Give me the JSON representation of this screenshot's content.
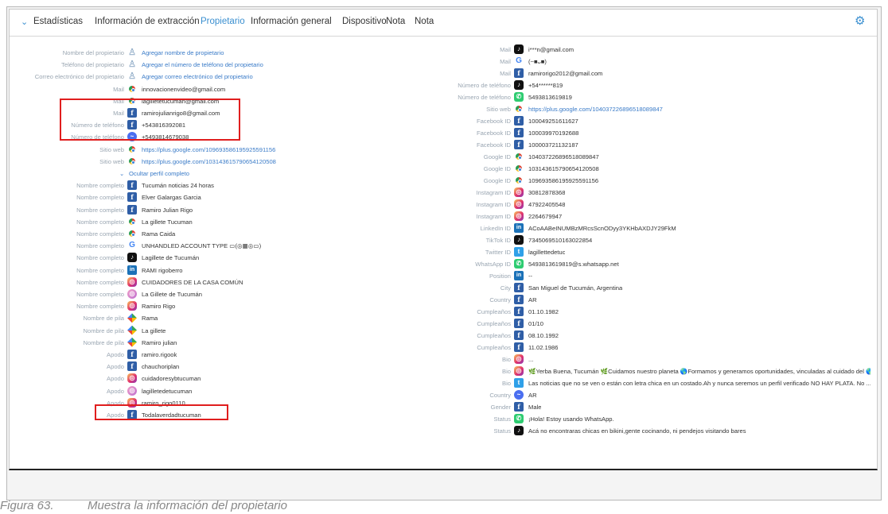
{
  "tabs": {
    "items": [
      "Estadísticas",
      "Información de extracción",
      "Propietario",
      "Información general",
      "Dispositivo",
      "Nota",
      "Nota"
    ],
    "active": 2
  },
  "left_rows": [
    {
      "label": "Nombre del propietario",
      "icon": "user-add-icon",
      "value": "Agregar nombre de propietario",
      "link": true
    },
    {
      "label": "Teléfono del propietario",
      "icon": "user-add-icon",
      "value": "Agregar el número de teléfono del propietario",
      "link": true
    },
    {
      "label": "Correo electrónico del propietario",
      "icon": "user-add-icon",
      "value": "Agregar correo electrónico del propietario",
      "link": true
    },
    {
      "label": "Mail",
      "icon": "chrome-icon",
      "value": "innovacionenvideo@gmail.com"
    },
    {
      "label": "Mail",
      "icon": "chrome-icon",
      "value": "lagilletetucuman@gmail.com"
    },
    {
      "label": "Mail",
      "icon": "facebook-icon",
      "value": "ramirojulianrigo8@gmail.com"
    },
    {
      "label": "Número de teléfono",
      "icon": "facebook-icon",
      "value": "+543816392081"
    },
    {
      "label": "Número de teléfono",
      "icon": "messenger-icon",
      "value": "+5493814679038"
    },
    {
      "label": "Sitio web",
      "icon": "chrome-icon",
      "value": "https://plus.google.com/109693586195925591156",
      "link": true
    },
    {
      "label": "Sitio web",
      "icon": "chrome-icon",
      "value": "https://plus.google.com/103143615790654120508",
      "link": true
    },
    {
      "label": "",
      "icon": "",
      "value": "Ocultar perfil completo",
      "link": true,
      "toggle": true
    },
    {
      "label": "Nombre completo",
      "icon": "facebook-icon",
      "value": "Tucumán noticias 24 horas"
    },
    {
      "label": "Nombre completo",
      "icon": "facebook-icon",
      "value": "Elver Galargas Garcia"
    },
    {
      "label": "Nombre completo",
      "icon": "facebook-icon",
      "value": "Ramiro Julian Rigo"
    },
    {
      "label": "Nombre completo",
      "icon": "chrome-icon",
      "value": "La gillete Tucuman"
    },
    {
      "label": "Nombre completo",
      "icon": "chrome-icon",
      "value": "Rama Caida"
    },
    {
      "label": "Nombre completo",
      "icon": "google-icon",
      "value": "UNHANDLED ACCOUNT TYPE ▭(◎▦◎▭)"
    },
    {
      "label": "Nombre completo",
      "icon": "tiktok-icon",
      "value": "Lagillete de Tucumán"
    },
    {
      "label": "Nombre completo",
      "icon": "linkedin-icon",
      "value": "RAMI rigoberro"
    },
    {
      "label": "Nombre completo",
      "icon": "instagram-icon",
      "value": "CUIDADORES DE LA CASA COMÚN"
    },
    {
      "label": "Nombre completo",
      "icon": "instagram-multi-icon",
      "value": "La Gillete de Tucumán"
    },
    {
      "label": "Nombre completo",
      "icon": "instagram-icon",
      "value": "Ramiro Rigo"
    },
    {
      "label": "Nombre de pila",
      "icon": "google-photos-icon",
      "value": "Rama"
    },
    {
      "label": "Nombre de pila",
      "icon": "google-photos-icon",
      "value": "La gillete"
    },
    {
      "label": "Nombre de pila",
      "icon": "google-photos-icon",
      "value": "Ramiro julian"
    },
    {
      "label": "Apodo",
      "icon": "facebook-icon",
      "value": "ramiro.rigook"
    },
    {
      "label": "Apodo",
      "icon": "facebook-icon",
      "value": "chauchoriplan"
    },
    {
      "label": "Apodo",
      "icon": "instagram-icon",
      "value": "cuidadoresybtucuman"
    },
    {
      "label": "Apodo",
      "icon": "instagram-multi-icon",
      "value": "lagilletedetucuman"
    },
    {
      "label": "Apodo",
      "icon": "instagram-icon",
      "value": "ramiro_rigo0110"
    },
    {
      "label": "Apodo",
      "icon": "facebook-icon",
      "value": "Todalaverdadtucuman"
    }
  ],
  "right_rows": [
    {
      "label": "Mail",
      "icon": "tiktok-icon",
      "value": "i***n@gmail.com"
    },
    {
      "label": "Mail",
      "icon": "google-icon",
      "value": "(~■ᴗ■)"
    },
    {
      "label": "Mail",
      "icon": "facebook-icon",
      "value": "ramirorigo2012@gmail.com"
    },
    {
      "label": "Número de teléfono",
      "icon": "tiktok-icon",
      "value": "+54******819"
    },
    {
      "label": "Número de teléfono",
      "icon": "whatsapp-icon",
      "value": "5493813619819"
    },
    {
      "label": "Sitio web",
      "icon": "chrome-icon",
      "value": "https://plus.google.com/104037226896518089847",
      "link": true
    },
    {
      "label": "Facebook ID",
      "icon": "facebook-icon",
      "value": "100049251611627"
    },
    {
      "label": "Facebook ID",
      "icon": "facebook-icon",
      "value": "100039970192688"
    },
    {
      "label": "Facebook ID",
      "icon": "facebook-icon",
      "value": "100003721132187"
    },
    {
      "label": "Google ID",
      "icon": "chrome-icon",
      "value": "104037226896518089847"
    },
    {
      "label": "Google ID",
      "icon": "chrome-icon",
      "value": "103143615790654120508"
    },
    {
      "label": "Google ID",
      "icon": "chrome-icon",
      "value": "109693586195925591156"
    },
    {
      "label": "Instagram ID",
      "icon": "instagram-icon",
      "value": "30812878368"
    },
    {
      "label": "Instagram ID",
      "icon": "instagram-icon",
      "value": "47922405548"
    },
    {
      "label": "Instagram ID",
      "icon": "instagram-icon",
      "value": "2264679947"
    },
    {
      "label": "LinkedIn ID",
      "icon": "linkedin-icon",
      "value": "ACoAABeINUMBzMRcsScnODyy3YKHbAXDJY29FkM"
    },
    {
      "label": "TikTok ID",
      "icon": "tiktok-icon",
      "value": "7345069510163022854"
    },
    {
      "label": "Twitter ID",
      "icon": "twitter-icon",
      "value": "lagillettedetuc"
    },
    {
      "label": "WhatsApp ID",
      "icon": "whatsapp-icon",
      "value": "5493813619819@s.whatsapp.net"
    },
    {
      "label": "Position",
      "icon": "linkedin-icon",
      "value": "--"
    },
    {
      "label": "City",
      "icon": "facebook-icon",
      "value": "San Miguel de Tucumán, Argentina"
    },
    {
      "label": "Country",
      "icon": "facebook-icon",
      "value": "AR"
    },
    {
      "label": "Cumpleaños",
      "icon": "facebook-icon",
      "value": "01.10.1982"
    },
    {
      "label": "Cumpleaños",
      "icon": "facebook-icon",
      "value": "01/10"
    },
    {
      "label": "Cumpleaños",
      "icon": "facebook-icon",
      "value": "08.10.1992"
    },
    {
      "label": "Cumpleaños",
      "icon": "facebook-icon",
      "value": "11.02.1986"
    },
    {
      "label": "Bio",
      "icon": "instagram-icon",
      "value": "..."
    },
    {
      "label": "Bio",
      "icon": "instagram-icon",
      "value": "🌿Yerba Buena, Tucumán 🌿Cuidamos nuestro planeta 🌎Formamos y generamos oportunidades, vinculadas al cuidado del 🌎..."
    },
    {
      "label": "Bio",
      "icon": "twitter-icon",
      "value": "Las noticias que no se ven o están con letra chica en un costado.Ah y nunca seremos un perfil verificado NO HAY PLATA. No ..."
    },
    {
      "label": "Country",
      "icon": "messenger-icon",
      "value": "AR"
    },
    {
      "label": "Gender",
      "icon": "facebook-icon",
      "value": "Male"
    },
    {
      "label": "Status",
      "icon": "whatsapp-icon",
      "value": "¡Hola! Estoy usando WhatsApp."
    },
    {
      "label": "Status",
      "icon": "tiktok-icon",
      "value": "Acá no encontraras chicas en bikini,gente cocinando, ni pendejos visitando bares"
    }
  ],
  "caption": {
    "number": "Figura 63.",
    "text": "Muestra la información del propietario"
  },
  "colors": {
    "accent": "#3a8fd0",
    "highlight": "#e01e1e"
  }
}
